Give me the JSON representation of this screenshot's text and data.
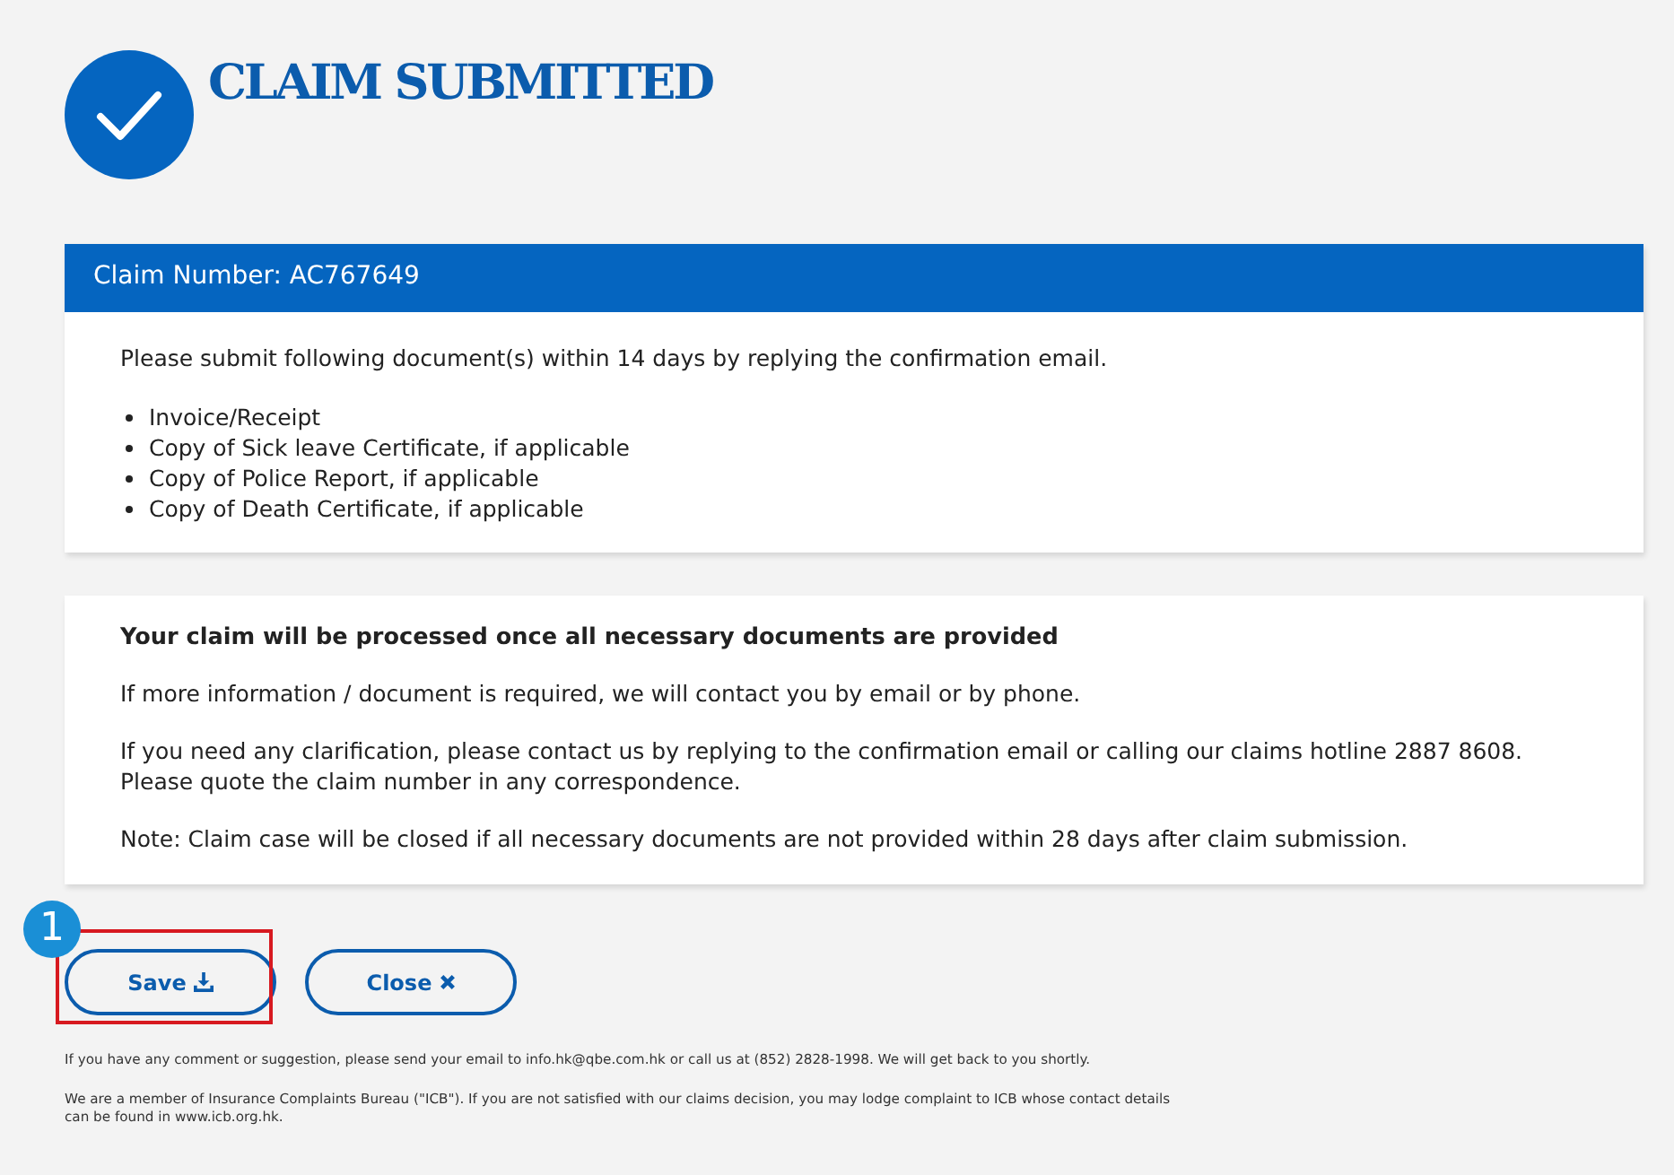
{
  "title": "CLAIM SUBMITTED",
  "claim_card": {
    "header": "Claim Number: AC767649",
    "intro": "Please submit following document(s) within 14 days by replying the confirmation email.",
    "documents": [
      "Invoice/Receipt",
      "Copy of Sick leave Certificate, if applicable",
      "Copy of Police Report, if applicable",
      "Copy of Death Certificate, if applicable"
    ]
  },
  "info_card": {
    "heading": "Your claim will be processed once all necessary documents are provided",
    "paragraphs": [
      "If more information / document is required, we will contact you by email or by phone.",
      "If you need any clarification, please contact us by replying to the confirmation email or calling our claims hotline 2887 8608. Please quote the claim number in any correspondence.",
      "Note: Claim case will be closed if all necessary documents are not provided within 28 days after claim submission."
    ]
  },
  "buttons": [
    {
      "label": "Save",
      "kind": "save",
      "highlighted": true
    },
    {
      "label": "Close",
      "kind": "close",
      "highlighted": false
    }
  ],
  "callout": "1",
  "footer": [
    "If you have any comment or suggestion, please send your email to info.hk@qbe.com.hk or call us at (852) 2828-1998. We will get back to you shortly.",
    "We are a member of Insurance Complaints Bureau (\"ICB\"). If you are not satisfied with our claims decision, you may lodge complaint to ICB whose contact details can be found in www.icb.org.hk."
  ]
}
